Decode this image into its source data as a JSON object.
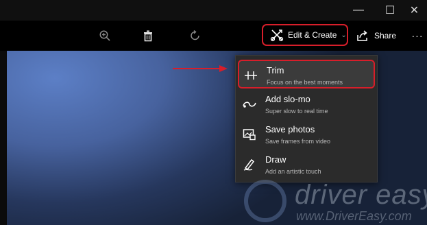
{
  "window_controls": {
    "minimize_glyph": "—",
    "maximize_glyph": "☐",
    "close_glyph": "✕"
  },
  "toolbar": {
    "zoom_icon": "zoom-in-icon",
    "delete_icon": "trash-icon",
    "rotate_icon": "rotate-icon",
    "edit_create_label": "Edit & Create",
    "edit_create_chevron": "⌄",
    "share_label": "Share",
    "more_glyph": "···"
  },
  "menu": {
    "items": [
      {
        "icon": "trim-icon",
        "title": "Trim",
        "subtitle": "Focus on the best moments"
      },
      {
        "icon": "slo-mo-icon",
        "title": "Add slo-mo",
        "subtitle": "Super slow to real time"
      },
      {
        "icon": "save-photos-icon",
        "title": "Save photos",
        "subtitle": "Save frames from video"
      },
      {
        "icon": "draw-icon",
        "title": "Draw",
        "subtitle": "Add an artistic touch"
      }
    ]
  },
  "watermark": {
    "brand": "driver easy",
    "url": "www.DriverEasy.com"
  },
  "colors": {
    "highlight_red": "#d81e2a",
    "menu_bg": "#2b2b2b",
    "sky_blue": "#47629e"
  }
}
